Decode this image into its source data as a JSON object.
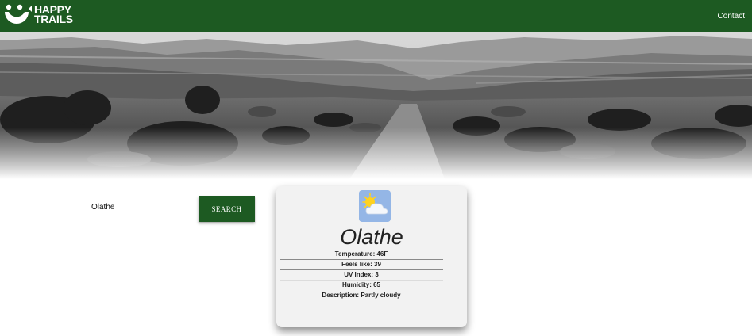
{
  "nav": {
    "logo_line1": "HAPPY",
    "logo_line2": "TRAILS",
    "contact_label": "Contact"
  },
  "search": {
    "input_value": "Olathe",
    "button_label": "SEARCH"
  },
  "weather": {
    "icon": "partly-cloudy-icon",
    "city": "Olathe",
    "temperature": "Temperature: 46F",
    "feels_like": "Feels like: 39",
    "uv_index": "UV Index: 3",
    "humidity": "Humidity: 65",
    "description": "Description: Partly cloudy"
  },
  "colors": {
    "brand_green": "#1d5a22",
    "card_background": "#f2f2f2",
    "icon_tile": "#94b6e6"
  }
}
